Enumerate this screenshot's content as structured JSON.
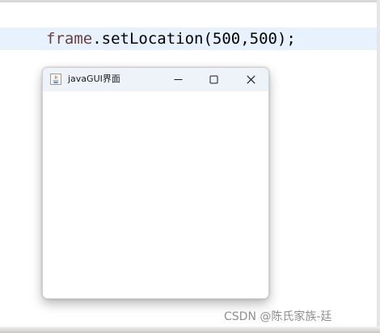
{
  "code": {
    "identifier": "frame",
    "line_rest": ".setLocation(500,500);"
  },
  "window": {
    "title": "javaGUI界面",
    "buttons": {
      "minimize_icon": "minimize-icon",
      "maximize_icon": "maximize-icon",
      "close_icon": "close-icon"
    }
  },
  "watermark": {
    "text": "CSDN @陈氏家族-廷"
  },
  "colors": {
    "highlight_line": "#e8f2fe",
    "identifier": "#6a3e3e",
    "titlebar": "#eef2f9"
  }
}
